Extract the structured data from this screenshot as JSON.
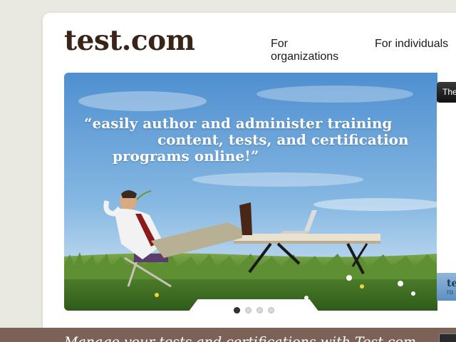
{
  "header": {
    "logo_text": "test.com",
    "nav": {
      "organizations": "For organizations",
      "individuals": "For individuals"
    }
  },
  "hero": {
    "quote_lines": [
      "“easily author and administer training",
      "content, tests, and certification",
      "programs online!”"
    ],
    "image_icon": "man-relaxing-at-laptop-desk-in-field",
    "slide_count": 4,
    "active_slide": 1
  },
  "side_tab": {
    "label": "The"
  },
  "side_thumb": {
    "text": "te",
    "subtext": "ro"
  },
  "bottom_bar": {
    "text": "Manage your tests and certifications with Test.com"
  },
  "colors": {
    "background": "#e9e8e1",
    "logo": "#3a2418",
    "bottom_bar": "#7c6157"
  }
}
